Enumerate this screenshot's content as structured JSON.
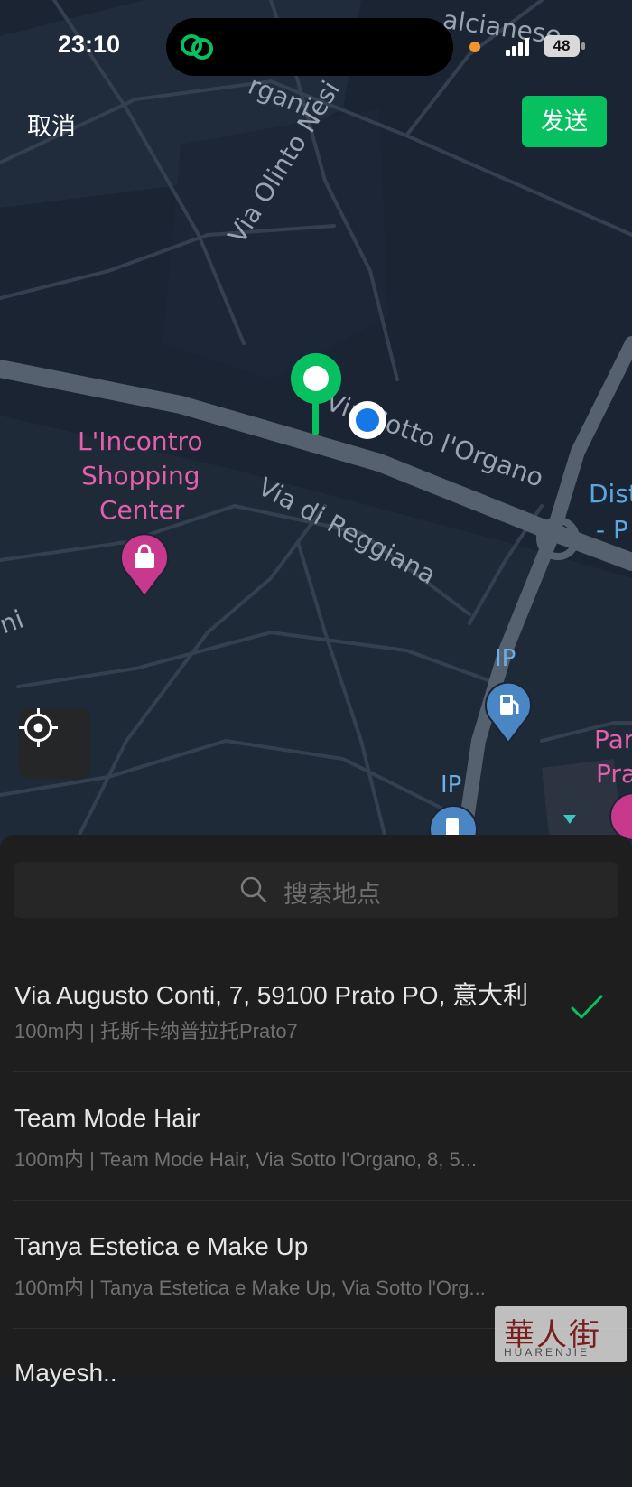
{
  "status_bar": {
    "time": "23:10",
    "battery": "48"
  },
  "header": {
    "cancel_label": "取消",
    "send_label": "发送"
  },
  "map": {
    "street_labels": [
      "alcianese",
      "rgani",
      "Via Olinto Nesi",
      "Via Sotto l'Organo",
      "Via di Reggiana",
      "ni",
      "Dist",
      "- P"
    ],
    "pois": {
      "shopping_center_line1": "L'Incontro",
      "shopping_center_line2": "Shopping",
      "shopping_center_line3": "Center",
      "fuel_1": "IP",
      "fuel_2": "IP",
      "right_poi_line1": "Par",
      "right_poi_line2": "Pra"
    },
    "colors": {
      "pin": "#07c160",
      "user_dot": "#1677e6",
      "shopping": "#c8388d",
      "fuel": "#4a86c4"
    }
  },
  "search": {
    "placeholder": "搜索地点"
  },
  "results": [
    {
      "title": "Via Augusto Conti, 7, 59100 Prato PO, 意大利",
      "subtitle": "100m内 | 托斯卡纳普拉托Prato7",
      "selected": true
    },
    {
      "title": "Team Mode Hair",
      "subtitle": "100m内 | Team Mode Hair, Via Sotto l'Organo, 8, 5...",
      "selected": false
    },
    {
      "title": "Tanya Estetica e Make Up",
      "subtitle": "100m内 | Tanya Estetica e Make Up, Via Sotto l'Org...",
      "selected": false
    },
    {
      "title": "Mayesh..",
      "subtitle": "",
      "selected": false
    }
  ],
  "watermark": {
    "cjk": "華人街",
    "latin": "HUARENJIE"
  }
}
